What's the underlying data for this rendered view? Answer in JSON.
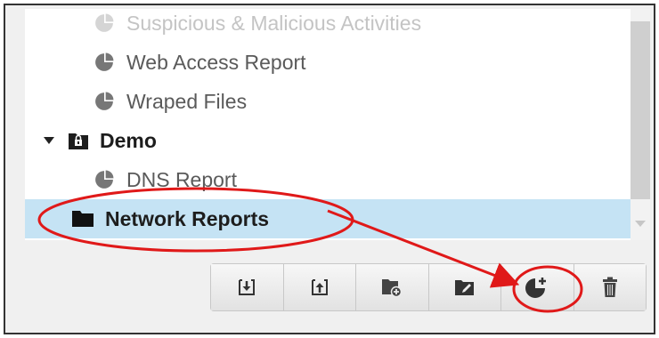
{
  "tree": {
    "items": [
      {
        "label": "Suspicious & Malicious Activities",
        "icon": "report-pie-icon"
      },
      {
        "label": "Web Access Report",
        "icon": "report-pie-icon"
      },
      {
        "label": "Wraped Files",
        "icon": "report-pie-icon"
      },
      {
        "label": "Demo",
        "icon": "folder-lock-icon",
        "expanded": true
      },
      {
        "label": "DNS Report",
        "icon": "report-pie-icon"
      },
      {
        "label": "Network Reports",
        "icon": "folder-icon",
        "selected": true
      }
    ]
  },
  "toolbar": {
    "buttons": [
      {
        "name": "import-button",
        "icon": "import-icon"
      },
      {
        "name": "export-button",
        "icon": "export-icon"
      },
      {
        "name": "add-folder-button",
        "icon": "folder-plus-icon"
      },
      {
        "name": "rename-folder-button",
        "icon": "folder-edit-icon"
      },
      {
        "name": "add-report-button",
        "icon": "pie-plus-icon",
        "highlighted": true
      },
      {
        "name": "delete-button",
        "icon": "trash-icon"
      }
    ]
  },
  "colors": {
    "selection": "#c5e3f4",
    "annotation": "#e01919"
  }
}
